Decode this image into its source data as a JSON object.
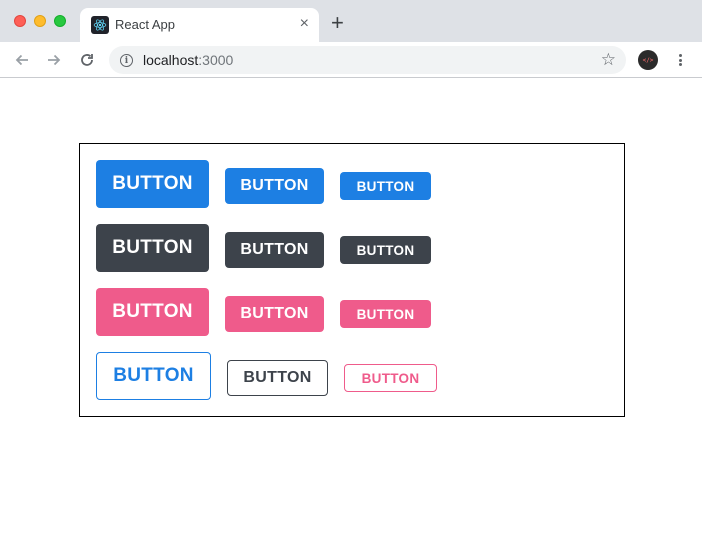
{
  "browser": {
    "tab": {
      "title": "React App",
      "close_glyph": "×"
    },
    "new_tab_glyph": "+",
    "address": {
      "host": "localhost",
      "port": ":3000"
    },
    "icons": {
      "favicon": "react-logo-icon",
      "back": "arrow-left-icon",
      "forward": "arrow-right-icon",
      "reload": "reload-icon",
      "info": "info-icon",
      "bookmark": "star-icon",
      "extension": "code-extension-icon",
      "menu": "more-vertical-icon"
    },
    "extension_label": "</>"
  },
  "colors": {
    "blue": "#1d7fe3",
    "dark": "#3d434b",
    "pink": "#ef5b8b"
  },
  "buttons": {
    "rows": [
      {
        "variant": "filled",
        "color": "blue",
        "labels": [
          "BUTTON",
          "BUTTON",
          "BUTTON"
        ]
      },
      {
        "variant": "filled",
        "color": "dark",
        "labels": [
          "BUTTON",
          "BUTTON",
          "BUTTON"
        ]
      },
      {
        "variant": "filled",
        "color": "pink",
        "labels": [
          "BUTTON",
          "BUTTON",
          "BUTTON"
        ]
      },
      {
        "variant": "outline",
        "colors": [
          "blue",
          "dark",
          "pink"
        ],
        "labels": [
          "BUTTON",
          "BUTTON",
          "BUTTON"
        ]
      }
    ]
  }
}
